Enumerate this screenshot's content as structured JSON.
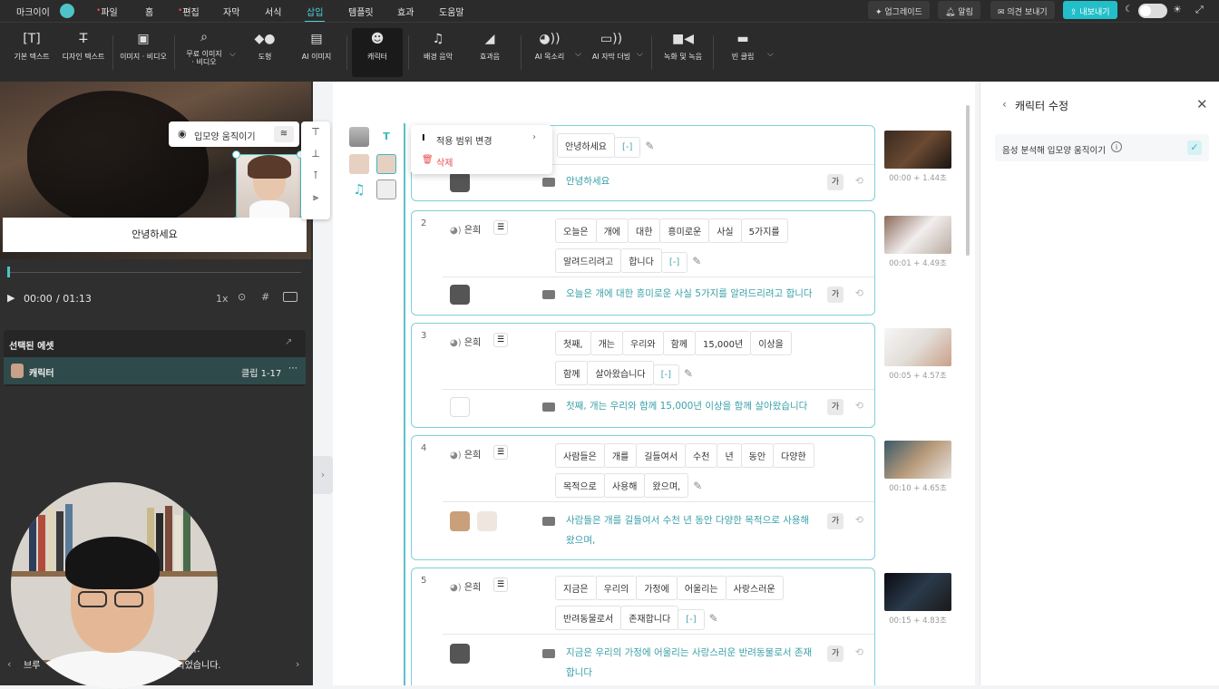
{
  "menubar": {
    "account": "마크이이",
    "items": [
      "파일",
      "홈",
      "편집",
      "자막",
      "서식",
      "삽입",
      "템플릿",
      "효과",
      "도움말"
    ],
    "active": "삽입",
    "upgrade": "업그레이드",
    "alert": "알림",
    "feedback": "의견 보내기",
    "export": "내보내기"
  },
  "toolbar": {
    "tools": [
      "기본 텍스트",
      "디자인 텍스트",
      "이미지 · 비디오",
      "무료 이미지\n· 비디오",
      "도형",
      "AI 이미지",
      "캐릭터",
      "배경 음악",
      "효과음",
      "AI 목소리",
      "AI 자막 더빙",
      "녹화 및 녹음",
      "빈 클립"
    ]
  },
  "preview": {
    "subtitle": "안녕하세요",
    "lip_label": "입모양 움직이기",
    "time_current": "00:00",
    "time_total": "/ 01:13",
    "speed": "1x"
  },
  "assets": {
    "title": "선택된 에셋",
    "item": "캐릭터",
    "range": "클립 1-17"
  },
  "webcam_caption": {
    "line1": "다.",
    "line2": "브루",
    "line3": "되었습니다."
  },
  "context_menu": {
    "scope": "적용 범위 변경",
    "delete": "삭제"
  },
  "clips": [
    {
      "num": "1",
      "speaker": "",
      "words": [
        "안녕하세요",
        "[-]"
      ],
      "subtitle": "안녕하세요",
      "thumb_time": "00:00 + 1.44초"
    },
    {
      "num": "2",
      "speaker": "은희",
      "words": [
        "오늘은",
        "개에",
        "대한",
        "흥미로운",
        "사실",
        "5가지를",
        "알려드리려고",
        "합니다",
        "[-]"
      ],
      "subtitle": "오늘은 개에 대한 흥미로운 사실 5가지를 알려드리려고 합니다",
      "thumb_time": "00:01 + 4.49초"
    },
    {
      "num": "3",
      "speaker": "은희",
      "words": [
        "첫째,",
        "개는",
        "우리와",
        "함께",
        "15,000년",
        "이상을",
        "함께",
        "살아왔습니다",
        "[-]"
      ],
      "subtitle": "첫째, 개는 우리와 함께 15,000년 이상을 함께 살아왔습니다",
      "thumb_time": "00:05 + 4.57초"
    },
    {
      "num": "4",
      "speaker": "은희",
      "words": [
        "사람들은",
        "개를",
        "길들여서",
        "수천",
        "년",
        "동안",
        "다양한",
        "목적으로",
        "사용해",
        "왔으며,"
      ],
      "subtitle": "사람들은 개를 길들여서 수천 년 동안 다양한 목적으로 사용해 왔으며,",
      "thumb_time": "00:10 + 4.65초"
    },
    {
      "num": "5",
      "speaker": "은희",
      "words": [
        "지금은",
        "우리의",
        "가정에",
        "어울리는",
        "사랑스러운",
        "반려동물로서",
        "존재합니다",
        "[-]"
      ],
      "subtitle": "지금은 우리의 가정에 어울리는 사랑스러운 반려동물로서 존재합니다",
      "thumb_time": "00:15 + 4.83초"
    }
  ],
  "ga_label": "가",
  "rightpanel": {
    "title": "캐릭터 수정",
    "option": "음성 분석해 입모양 움직이기"
  }
}
